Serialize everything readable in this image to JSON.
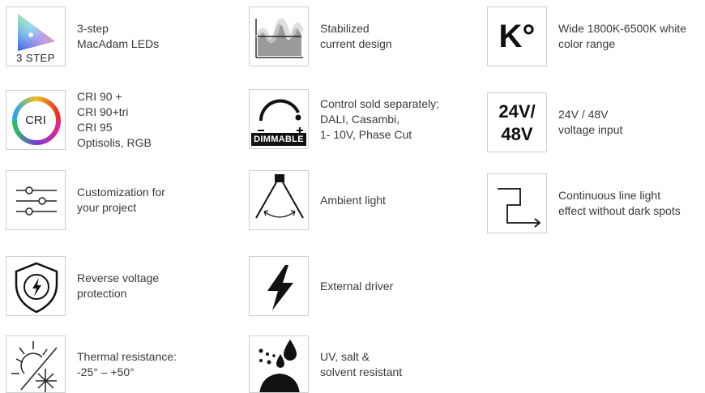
{
  "features": {
    "macadam": {
      "icon": "color-gamut-icon",
      "badge": "3 STEP",
      "lines": [
        "3-step",
        "MacAdam LEDs"
      ]
    },
    "stabilized": {
      "icon": "current-wave-icon",
      "lines": [
        "Stabilized",
        "current design"
      ]
    },
    "color_range": {
      "icon": "kelvin-icon",
      "badge": "K°",
      "lines": [
        "Wide 1800K-6500K white",
        "color range"
      ]
    },
    "cri": {
      "icon": "cri-ring-icon",
      "badge": "CRI",
      "lines": [
        "CRI 90 +",
        "CRI 90+tri",
        "CRI 95",
        "Optisolis, RGB"
      ]
    },
    "control": {
      "icon": "dimmer-knob-icon",
      "badge": "DIMMABLE",
      "lines": [
        "Control sold separately;",
        "DALI, Casambi,",
        "1- 10V, Phase Cut"
      ]
    },
    "voltage": {
      "icon": "voltage-icon",
      "badge_line1": "24V/",
      "badge_line2": "48V",
      "lines": [
        "24V / 48V",
        "voltage input"
      ]
    },
    "customization": {
      "icon": "sliders-icon",
      "lines": [
        "Customization for",
        "your project"
      ]
    },
    "ambient": {
      "icon": "light-beam-icon",
      "lines": [
        "Ambient light"
      ]
    },
    "continuous": {
      "icon": "continuous-line-icon",
      "lines": [
        "Continuous line light",
        "effect without dark spots"
      ]
    },
    "reverse": {
      "icon": "shield-bolt-icon",
      "lines": [
        "Reverse voltage",
        "protection"
      ]
    },
    "driver": {
      "icon": "lightning-icon",
      "lines": [
        "External driver"
      ]
    },
    "thermal": {
      "icon": "sun-snow-icon",
      "lines": [
        "Thermal resistance:",
        "-25° – +50°"
      ]
    },
    "resistant": {
      "icon": "drops-umbrella-icon",
      "lines": [
        "UV, salt &",
        "solvent resistant"
      ]
    }
  }
}
